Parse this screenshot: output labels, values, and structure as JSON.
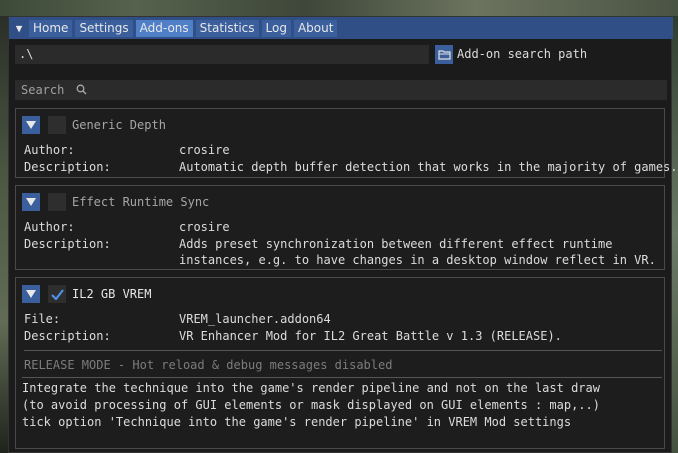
{
  "menu": {
    "tabs": [
      "Home",
      "Settings",
      "Add-ons",
      "Statistics",
      "Log",
      "About"
    ],
    "active": "Add-ons"
  },
  "path": {
    "value": ".\\",
    "button_label": "Add-on search path"
  },
  "search": {
    "placeholder": "Search"
  },
  "addons": [
    {
      "name": "Generic Depth",
      "enabled": false,
      "author_label": "Author:",
      "author": "crosire",
      "desc_label": "Description:",
      "description": "Automatic depth buffer detection that works in the majority of games."
    },
    {
      "name": "Effect Runtime Sync",
      "enabled": false,
      "author_label": "Author:",
      "author": "crosire",
      "desc_label": "Description:",
      "description_lines": [
        "Adds preset synchronization between different effect runtime",
        "instances, e.g. to have changes in a desktop window reflect in VR."
      ]
    },
    {
      "name": "IL2 GB VREM",
      "enabled": true,
      "file_label": "File:",
      "file": "VREM_launcher.addon64",
      "desc_label": "Description:",
      "description": "VR Enhancer Mod for IL2 Great Battle v 1.3 (RELEASE).",
      "mode": "RELEASE MODE - Hot reload & debug messages disabled",
      "note_lines": [
        "Integrate the technique into the game's render pipeline and not on the last draw",
        "(to avoid processing of GUI elements or mask displayed on GUI elements : map,..)",
        "tick option 'Technique into the game's render pipeline' in VREM Mod settings"
      ]
    }
  ],
  "colors": {
    "menubar": "#2f4f86",
    "tab": "#3a5f9c",
    "tab_active": "#4f7fc7",
    "panel": "#1b1b1b",
    "check": "#4f8fe6"
  }
}
